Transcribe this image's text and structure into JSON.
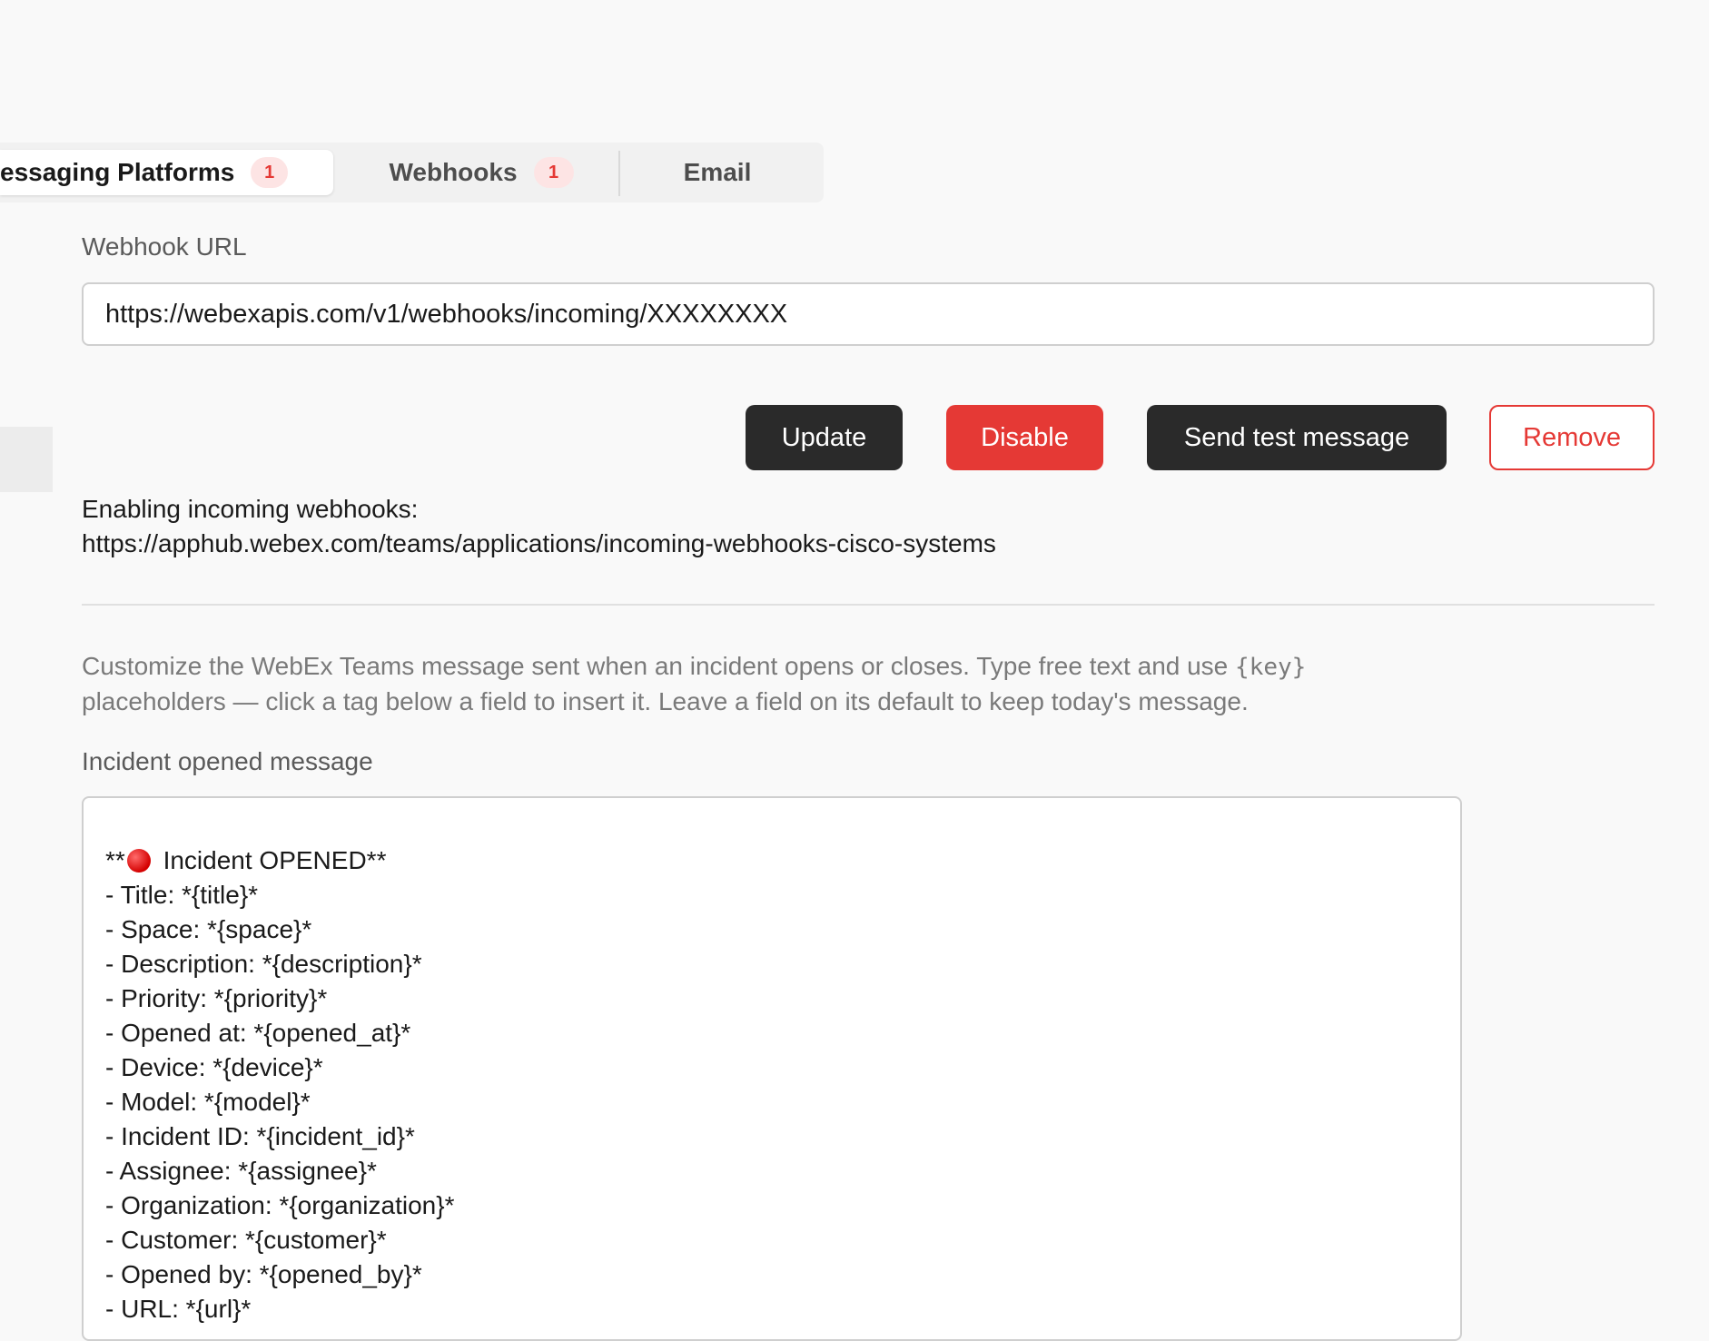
{
  "tabs": [
    {
      "label": "essaging Platforms",
      "badge": "1",
      "active": true
    },
    {
      "label": "Webhooks",
      "badge": "1",
      "active": false
    },
    {
      "label": "Email",
      "badge": null,
      "active": false
    }
  ],
  "webhook": {
    "label": "Webhook URL",
    "value": "https://webexapis.com/v1/webhooks/incoming/XXXXXXXX"
  },
  "actions": {
    "update": "Update",
    "disable": "Disable",
    "send_test": "Send test message",
    "remove": "Remove"
  },
  "info": {
    "line1": "Enabling incoming webhooks:",
    "line2": "https://apphub.webex.com/teams/applications/incoming-webhooks-cisco-systems"
  },
  "help": {
    "part1": "Customize the WebEx Teams message sent when an incident opens or closes. Type free text and use ",
    "code": "{key}",
    "part2": " placeholders — click a tag below a field to insert it. Leave a field on its default to keep today's message."
  },
  "opened_message": {
    "label": "Incident opened message",
    "head_prefix": "**",
    "head_icon": "red-circle-icon",
    "head_text": " Incident OPENED**",
    "lines": [
      "- Title: *{title}*",
      "- Space: *{space}*",
      "- Description: *{description}*",
      "- Priority: *{priority}*",
      "- Opened at: *{opened_at}*",
      "- Device: *{device}*",
      "- Model: *{model}*",
      "- Incident ID: *{incident_id}*",
      "- Assignee: *{assignee}*",
      "- Organization: *{organization}*",
      "- Customer: *{customer}*",
      "- Opened by: *{opened_by}*",
      "- URL: *{url}*"
    ]
  },
  "colors": {
    "accent_red": "#e53935",
    "dark_button": "#2a2a2a",
    "badge_bg": "#fde4e4"
  }
}
